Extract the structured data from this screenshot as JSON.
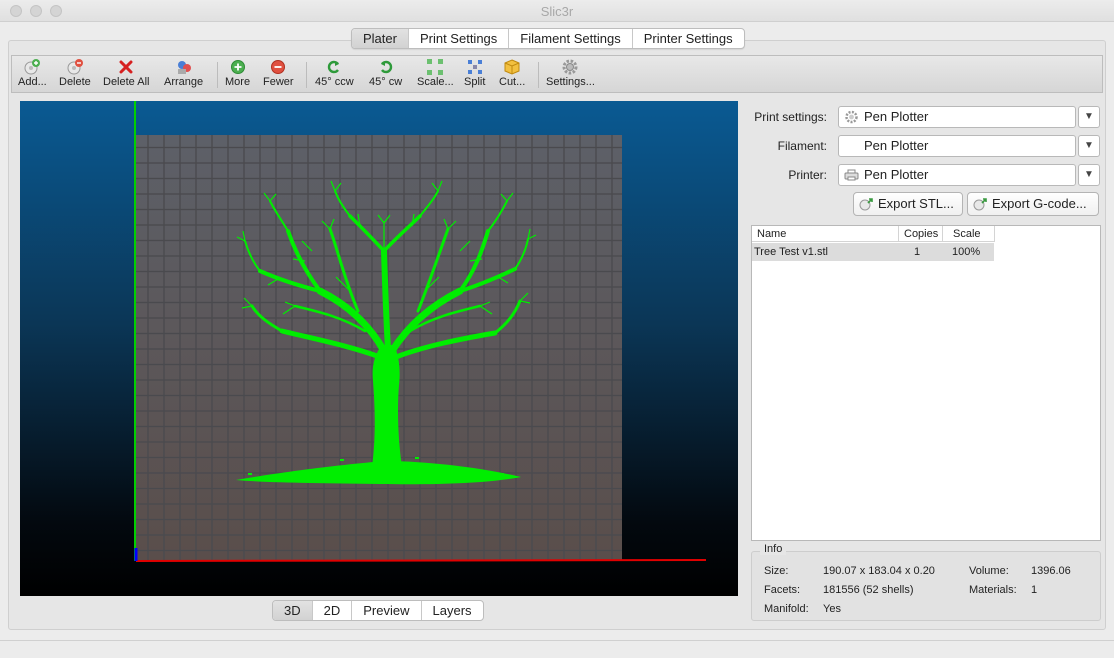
{
  "window": {
    "title": "Slic3r"
  },
  "tabs": [
    {
      "label": "Plater",
      "active": true
    },
    {
      "label": "Print Settings",
      "active": false
    },
    {
      "label": "Filament Settings",
      "active": false
    },
    {
      "label": "Printer Settings",
      "active": false
    }
  ],
  "toolbar": {
    "add": "Add...",
    "delete": "Delete",
    "delete_all": "Delete All",
    "arrange": "Arrange",
    "more": "More",
    "fewer": "Fewer",
    "rotate_ccw": "45° ccw",
    "rotate_cw": "45° cw",
    "scale": "Scale...",
    "split": "Split",
    "cut": "Cut...",
    "settings": "Settings..."
  },
  "view_tabs": [
    {
      "label": "3D",
      "active": true
    },
    {
      "label": "2D",
      "active": false
    },
    {
      "label": "Preview",
      "active": false
    },
    {
      "label": "Layers",
      "active": false
    }
  ],
  "settings": {
    "print_label": "Print settings:",
    "print_value": "Pen Plotter",
    "filament_label": "Filament:",
    "filament_value": "Pen Plotter",
    "printer_label": "Printer:",
    "printer_value": "Pen Plotter"
  },
  "buttons": {
    "export_stl": "Export STL...",
    "export_gcode": "Export G-code..."
  },
  "object_list": {
    "columns": [
      "Name",
      "Copies",
      "Scale"
    ],
    "rows": [
      {
        "name": "Tree Test v1.stl",
        "copies": "1",
        "scale": "100%"
      }
    ]
  },
  "info": {
    "title": "Info",
    "size_label": "Size:",
    "size_value": "190.07 x 183.04 x 0.20",
    "volume_label": "Volume:",
    "volume_value": "1396.06",
    "facets_label": "Facets:",
    "facets_value": "181556 (52 shells)",
    "materials_label": "Materials:",
    "materials_value": "1",
    "manifold_label": "Manifold:",
    "manifold_value": "Yes"
  },
  "colors": {
    "model": "#00ee00",
    "axis_x": "#e00000",
    "axis_y": "#00d000",
    "axis_z": "#0000ff",
    "bed": "#5e5e62"
  },
  "icons": {
    "add": "add-object-icon",
    "delete": "delete-object-icon",
    "delete_all": "red-x-icon",
    "arrange": "arrange-icon",
    "more": "plus-circle-icon",
    "fewer": "minus-circle-icon",
    "rotate_ccw": "rotate-ccw-icon",
    "rotate_cw": "rotate-cw-icon",
    "scale": "scale-icon",
    "split": "split-icon",
    "cut": "cut-box-icon",
    "settings": "gear-icon"
  }
}
